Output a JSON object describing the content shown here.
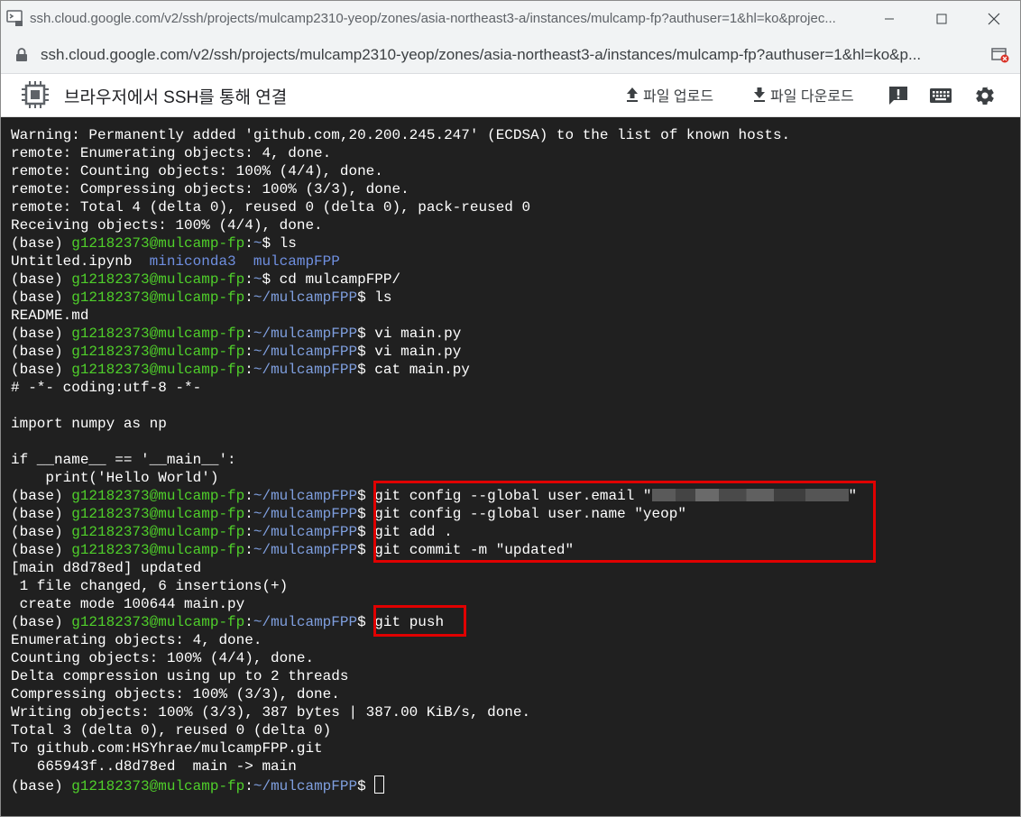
{
  "window": {
    "title": "ssh.cloud.google.com/v2/ssh/projects/mulcamp2310-yeop/zones/asia-northeast3-a/instances/mulcamp-fp?authuser=1&hl=ko&projec...",
    "url": "ssh.cloud.google.com/v2/ssh/projects/mulcamp2310-yeop/zones/asia-northeast3-a/instances/mulcamp-fp?authuser=1&hl=ko&p..."
  },
  "toolbar": {
    "title": "브라우저에서 SSH를 통해 연결",
    "upload_label": "파일 업로드",
    "download_label": "파일 다운로드"
  },
  "terminal": {
    "prompt_base": "(base) ",
    "prompt_user": "g12182373@mulcamp-fp",
    "prompt_home": "~",
    "prompt_proj": "~/mulcampFPP",
    "lines": [
      {
        "kind": "text",
        "text": "Warning: Permanently added 'github.com,20.200.245.247' (ECDSA) to the list of known hosts."
      },
      {
        "kind": "text",
        "text": "remote: Enumerating objects: 4, done."
      },
      {
        "kind": "text",
        "text": "remote: Counting objects: 100% (4/4), done."
      },
      {
        "kind": "text",
        "text": "remote: Compressing objects: 100% (3/3), done."
      },
      {
        "kind": "text",
        "text": "remote: Total 4 (delta 0), reused 0 (delta 0), pack-reused 0"
      },
      {
        "kind": "text",
        "text": "Receiving objects: 100% (4/4), done."
      },
      {
        "kind": "prompt",
        "path": "~",
        "cmd": "ls"
      },
      {
        "kind": "ls",
        "file": "Untitled.ipynb",
        "dir1": "miniconda3",
        "dir2": "mulcampFPP"
      },
      {
        "kind": "prompt",
        "path": "~",
        "cmd": "cd mulcampFPP/"
      },
      {
        "kind": "prompt",
        "path": "~/mulcampFPP",
        "cmd": "ls"
      },
      {
        "kind": "text",
        "text": "README.md"
      },
      {
        "kind": "prompt",
        "path": "~/mulcampFPP",
        "cmd": "vi main.py"
      },
      {
        "kind": "prompt",
        "path": "~/mulcampFPP",
        "cmd": "vi main.py"
      },
      {
        "kind": "prompt",
        "path": "~/mulcampFPP",
        "cmd": "cat main.py"
      },
      {
        "kind": "text",
        "text": "# -*- coding:utf-8 -*-"
      },
      {
        "kind": "text",
        "text": ""
      },
      {
        "kind": "text",
        "text": "import numpy as np"
      },
      {
        "kind": "text",
        "text": ""
      },
      {
        "kind": "text",
        "text": "if __name__ == '__main__':"
      },
      {
        "kind": "text",
        "text": "    print('Hello World')"
      },
      {
        "kind": "prompt_redacted",
        "path": "~/mulcampFPP",
        "cmd": "git config --global user.email \"",
        "after": "\""
      },
      {
        "kind": "prompt",
        "path": "~/mulcampFPP",
        "cmd": "git config --global user.name \"yeop\""
      },
      {
        "kind": "prompt",
        "path": "~/mulcampFPP",
        "cmd": "git add ."
      },
      {
        "kind": "prompt",
        "path": "~/mulcampFPP",
        "cmd": "git commit -m \"updated\""
      },
      {
        "kind": "text",
        "text": "[main d8d78ed] updated"
      },
      {
        "kind": "text",
        "text": " 1 file changed, 6 insertions(+)"
      },
      {
        "kind": "text",
        "text": " create mode 100644 main.py"
      },
      {
        "kind": "prompt",
        "path": "~/mulcampFPP",
        "cmd": "git push"
      },
      {
        "kind": "text",
        "text": "Enumerating objects: 4, done."
      },
      {
        "kind": "text",
        "text": "Counting objects: 100% (4/4), done."
      },
      {
        "kind": "text",
        "text": "Delta compression using up to 2 threads"
      },
      {
        "kind": "text",
        "text": "Compressing objects: 100% (3/3), done."
      },
      {
        "kind": "text",
        "text": "Writing objects: 100% (3/3), 387 bytes | 387.00 KiB/s, done."
      },
      {
        "kind": "text",
        "text": "Total 3 (delta 0), reused 0 (delta 0)"
      },
      {
        "kind": "text",
        "text": "To github.com:HSYhrae/mulcampFPP.git"
      },
      {
        "kind": "text",
        "text": "   665943f..d8d78ed  main -> main"
      },
      {
        "kind": "prompt_cursor",
        "path": "~/mulcampFPP",
        "cmd": ""
      }
    ]
  },
  "colors": {
    "terminal_bg": "#202020",
    "user_green": "#4fcf2a",
    "path_blue": "#7f9fdf",
    "highlight_red": "#e00000"
  }
}
